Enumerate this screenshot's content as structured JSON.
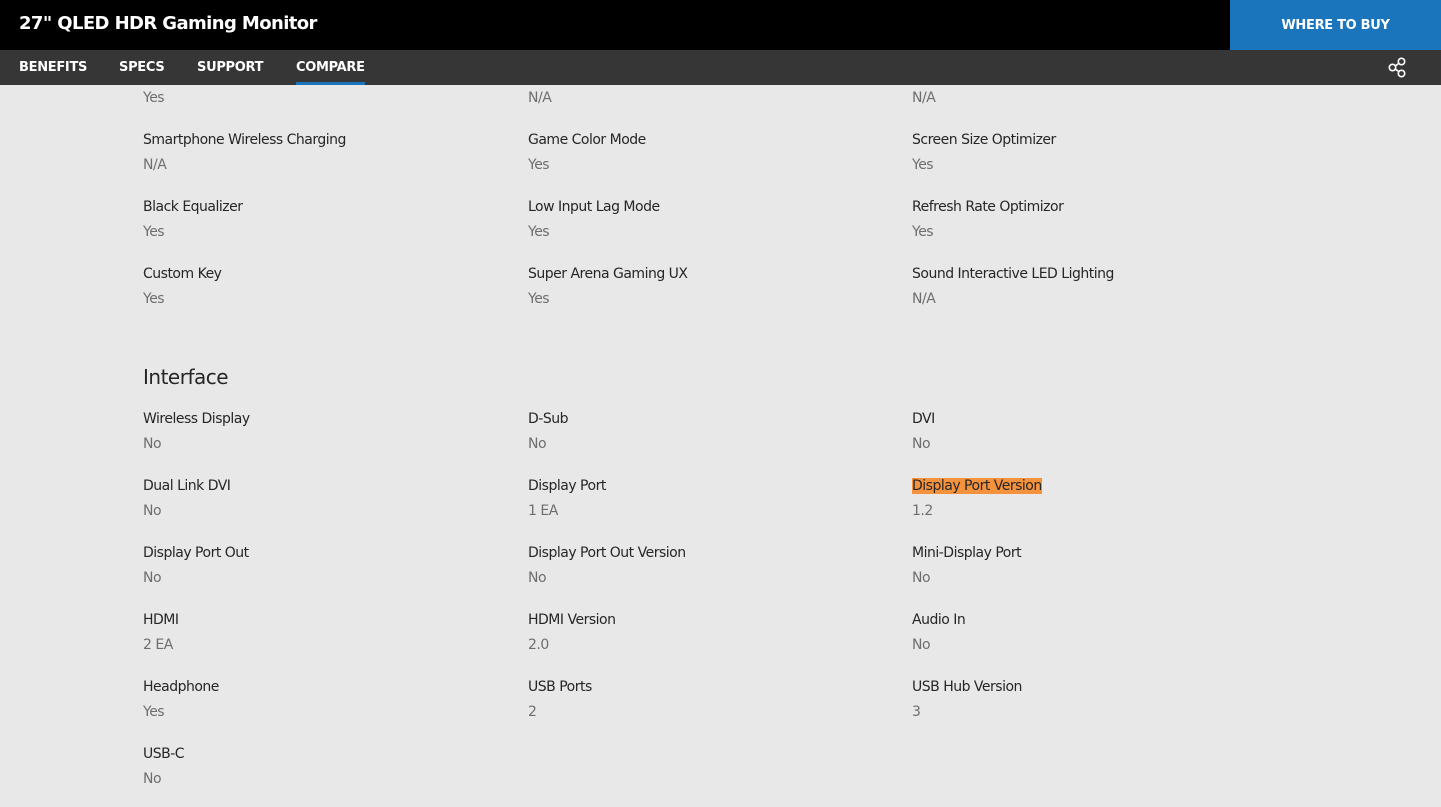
{
  "header": {
    "product_title": "27\" QLED HDR Gaming Monitor",
    "buy_button": "WHERE TO BUY"
  },
  "nav": {
    "items": [
      "BENEFITS",
      "SPECS",
      "SUPPORT",
      "COMPARE"
    ],
    "active": "COMPARE"
  },
  "colors": {
    "accent": "#1b75bc",
    "highlight": "#f5923e",
    "page_background": "#e8e8e8"
  },
  "gaming": {
    "partial_values": [
      "Yes",
      "N/A",
      "N/A"
    ],
    "rows": [
      [
        {
          "label": "Smartphone Wireless Charging",
          "value": "N/A"
        },
        {
          "label": "Game Color Mode",
          "value": "Yes"
        },
        {
          "label": "Screen Size Optimizer",
          "value": "Yes"
        }
      ],
      [
        {
          "label": "Black Equalizer",
          "value": "Yes"
        },
        {
          "label": "Low Input Lag Mode",
          "value": "Yes"
        },
        {
          "label": "Refresh Rate Optimizor",
          "value": "Yes"
        }
      ],
      [
        {
          "label": "Custom Key",
          "value": "Yes"
        },
        {
          "label": "Super Arena Gaming UX",
          "value": "Yes"
        },
        {
          "label": "Sound Interactive LED Lighting",
          "value": "N/A"
        }
      ]
    ]
  },
  "interface": {
    "heading": "Interface",
    "rows": [
      [
        {
          "label": "Wireless Display",
          "value": "No"
        },
        {
          "label": "D-Sub",
          "value": "No"
        },
        {
          "label": "DVI",
          "value": "No"
        }
      ],
      [
        {
          "label": "Dual Link DVI",
          "value": "No"
        },
        {
          "label": "Display Port",
          "value": "1 EA"
        },
        {
          "label": "Display Port Version",
          "value": "1.2"
        }
      ],
      [
        {
          "label": "Display Port Out",
          "value": "No"
        },
        {
          "label": "Display Port Out Version",
          "value": "No"
        },
        {
          "label": "Mini-Display Port",
          "value": "No"
        }
      ],
      [
        {
          "label": "HDMI",
          "value": "2 EA"
        },
        {
          "label": "HDMI Version",
          "value": "2.0"
        },
        {
          "label": "Audio In",
          "value": "No"
        }
      ],
      [
        {
          "label": "Headphone",
          "value": "Yes"
        },
        {
          "label": "USB Ports",
          "value": "2"
        },
        {
          "label": "USB Hub Version",
          "value": "3"
        }
      ],
      [
        {
          "label": "USB-C",
          "value": "No"
        }
      ]
    ],
    "highlighted_label": "Display Port Version"
  }
}
